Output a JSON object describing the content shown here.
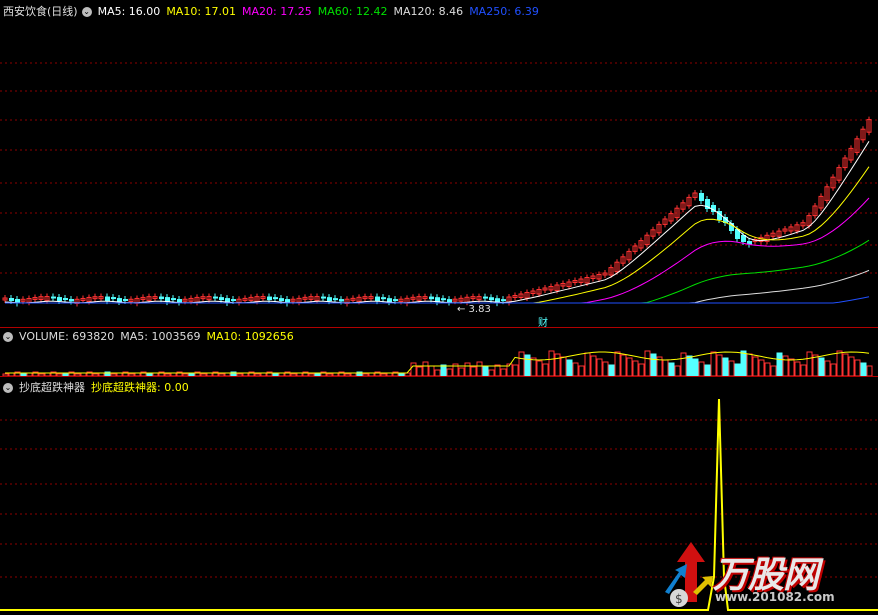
{
  "price_panel": {
    "title": "西安饮食(日线)",
    "ma": [
      {
        "label": "MA5: 16.00",
        "color": "#ffffff"
      },
      {
        "label": "MA10: 17.01",
        "color": "#ffff00"
      },
      {
        "label": "MA20: 17.25",
        "color": "#ff00ff"
      },
      {
        "label": "MA60: 12.42",
        "color": "#00e000"
      },
      {
        "label": "MA120: 8.46",
        "color": "#dcdcdc"
      },
      {
        "label": "MA250: 6.39",
        "color": "#2050ff"
      }
    ],
    "low_label": "← 3.83",
    "cai_label": "财"
  },
  "volume_panel": {
    "title": "VOLUME: 693820",
    "ma5": "MA5: 1003569",
    "ma10": "MA10: 1092656"
  },
  "indicator_panel": {
    "name": "抄底超跌神器",
    "value_label": "抄底超跌神器: 0.00"
  },
  "watermark": {
    "brand": "万股网",
    "url": "www.201082.com"
  },
  "colors": {
    "up": "#ff3232",
    "down": "#54ffff",
    "grid": "#8b0000",
    "indicator_line": "#ffff00"
  }
}
